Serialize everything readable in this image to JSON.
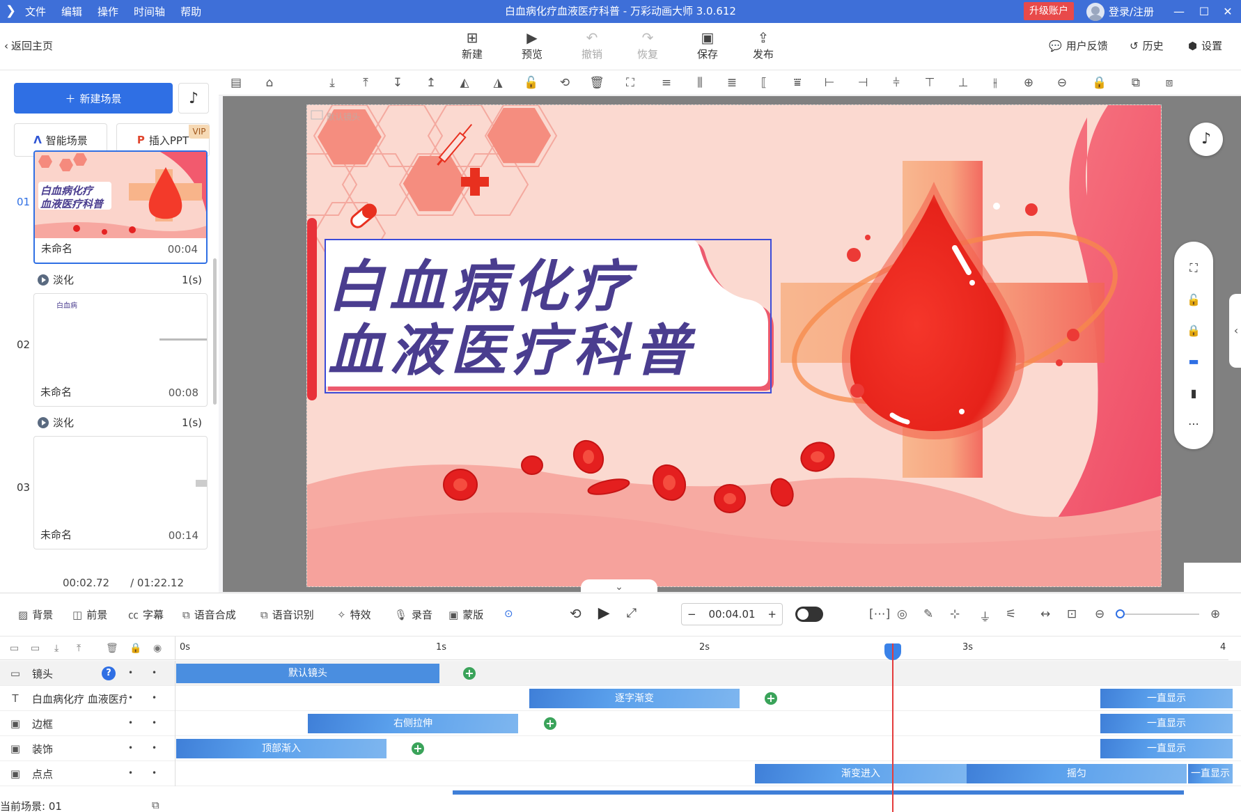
{
  "titlebar": {
    "menu": [
      "文件",
      "编辑",
      "操作",
      "时间轴",
      "帮助"
    ],
    "title": "白血病化疗血液医疗科普 - 万彩动画大师 3.0.612",
    "upgrade": "升级账户",
    "login": "登录/注册"
  },
  "toolbar": {
    "back": "返回主页",
    "new": "新建",
    "preview": "预览",
    "undo": "撤销",
    "redo": "恢复",
    "save": "保存",
    "publish": "发布",
    "feedback": "用户反馈",
    "history": "历史",
    "settings": "设置"
  },
  "left": {
    "new_scene": "新建场景",
    "smart_scene": "智能场景",
    "insert_ppt": "插入PPT",
    "vip": "VIP",
    "scenes": [
      {
        "num": "01",
        "name": "未命名",
        "time": "00:04",
        "thumb_line1": "白血病化疗",
        "thumb_line2": "血液医疗科普"
      },
      {
        "num": "02",
        "name": "未命名",
        "time": "00:08",
        "thumb_text": "白血病"
      },
      {
        "num": "03",
        "name": "未命名",
        "time": "00:14"
      }
    ],
    "transitions": [
      {
        "name": "淡化",
        "dur": "1(s)"
      },
      {
        "name": "淡化",
        "dur": "1(s)"
      }
    ],
    "current_time": "00:02.72",
    "total_time": "/ 01:22.12"
  },
  "stage": {
    "title_line1": "白血病化疗",
    "title_line2": "血液医疗科普",
    "default_label": "默认镜头"
  },
  "timeline": {
    "tools": [
      "背景",
      "前景",
      "字幕",
      "语音合成",
      "语音识别",
      "特效",
      "录音",
      "蒙版"
    ],
    "time_value": "00:04.01",
    "ruler": [
      "0s",
      "1s",
      "2s",
      "3s",
      "4"
    ],
    "tracks": [
      {
        "name": "镜头",
        "clips": [
          "默认镜头"
        ]
      },
      {
        "name": "白血病化疗 血液医疗",
        "clips": [
          "逐字渐变",
          "一直显示"
        ]
      },
      {
        "name": "边框",
        "clips": [
          "右侧拉伸",
          "一直显示"
        ]
      },
      {
        "name": "装饰",
        "clips": [
          "顶部渐入",
          "一直显示"
        ]
      },
      {
        "name": "点点",
        "clips": [
          "渐变进入",
          "摇匀",
          "一直显示"
        ]
      }
    ],
    "current_scene": "当前场景: 01"
  },
  "colors": {
    "accent": "#2f6fe4",
    "titlebar": "#3e6fd8",
    "title_text": "#4a3d8f",
    "drop_red": "#f23a2a",
    "bg_pink": "#fbd9d0"
  }
}
